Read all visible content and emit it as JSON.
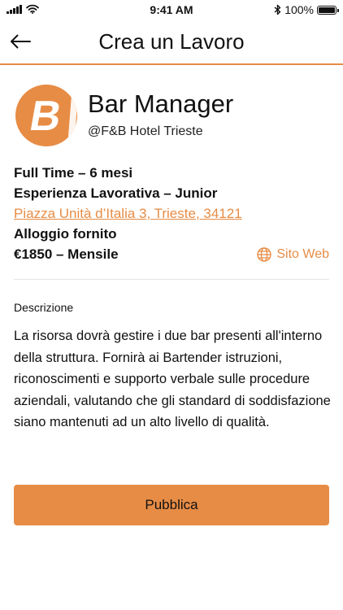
{
  "status_bar": {
    "time": "9:41 AM",
    "battery": "100%"
  },
  "nav": {
    "title": "Crea un Lavoro"
  },
  "job": {
    "title": "Bar Manager",
    "company": "@F&B Hotel Trieste",
    "logo_letter": "B",
    "type": "Full Time – 6 mesi",
    "experience": "Esperienza Lavorativa – Junior",
    "address": "Piazza Unità d’Italia 3, Trieste, 34121",
    "housing": "Alloggio fornito",
    "salary": "€1850 – Mensile",
    "website_label": "Sito Web"
  },
  "description": {
    "label": "Descrizione",
    "text": "La risorsa dovrà gestire i due bar presenti all'interno della struttura. Fornirà ai Bartender istruzioni, riconoscimenti e supporto verbale sulle procedure aziendali, valutando che gli standard di soddisfazione siano mantenuti ad un alto livello di qualità."
  },
  "actions": {
    "publish_label": "Pubblica"
  },
  "colors": {
    "accent": "#E78C45",
    "divider": "#E4E4E4",
    "text": "#111111"
  },
  "icons": {
    "back": "arrow-left-icon",
    "globe": "globe-icon",
    "wifi": "wifi-icon",
    "bluetooth": "bluetooth-icon",
    "battery": "battery-icon",
    "signal": "signal-icon"
  }
}
